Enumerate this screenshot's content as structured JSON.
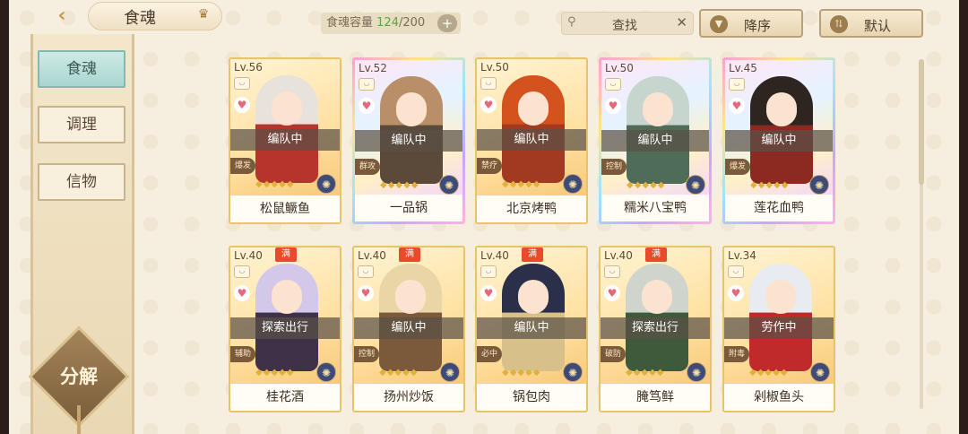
{
  "header": {
    "title": "食魂",
    "capacity_label": "食魂容量",
    "capacity_current": "124",
    "capacity_max": "/200",
    "capacity_add": "+",
    "search_placeholder": "查找",
    "search_clear": "✕",
    "sort_label": "降序",
    "default_label": "默认"
  },
  "sidebar": {
    "items": [
      {
        "label": "食魂",
        "active": true
      },
      {
        "label": "调理",
        "active": false
      },
      {
        "label": "信物",
        "active": false
      }
    ],
    "decompose_label": "分解"
  },
  "cards": [
    {
      "level": "Lv.56",
      "status": "编队中",
      "role": "爆发",
      "name": "松鼠鳜鱼",
      "full": false,
      "rainbow": false,
      "hair": "#e8e2dc",
      "outfit": "#b7342c"
    },
    {
      "level": "Lv.52",
      "status": "编队中",
      "role": "群攻",
      "name": "一品锅",
      "full": false,
      "rainbow": true,
      "hair": "#b98f6a",
      "outfit": "#5b4a3a"
    },
    {
      "level": "Lv.50",
      "status": "编队中",
      "role": "禁疗",
      "name": "北京烤鸭",
      "full": false,
      "rainbow": false,
      "hair": "#d4521e",
      "outfit": "#a23a22"
    },
    {
      "level": "Lv.50",
      "status": "编队中",
      "role": "控制",
      "name": "糯米八宝鸭",
      "full": false,
      "rainbow": true,
      "hair": "#c7d5cf",
      "outfit": "#4e6c58"
    },
    {
      "level": "Lv.45",
      "status": "编队中",
      "role": "爆发",
      "name": "莲花血鸭",
      "full": false,
      "rainbow": true,
      "hair": "#2d2520",
      "outfit": "#8c2a22"
    },
    {
      "level": "Lv.40",
      "status": "探索出行",
      "role": "辅助",
      "name": "桂花酒",
      "full": true,
      "rainbow": false,
      "hair": "#d3c8ea",
      "outfit": "#3f3148"
    },
    {
      "level": "Lv.40",
      "status": "编队中",
      "role": "控制",
      "name": "扬州炒饭",
      "full": true,
      "rainbow": false,
      "hair": "#e9d6a6",
      "outfit": "#7a5a3a"
    },
    {
      "level": "Lv.40",
      "status": "编队中",
      "role": "必中",
      "name": "锅包肉",
      "full": true,
      "rainbow": false,
      "hair": "#2a2f4a",
      "outfit": "#d8c08a"
    },
    {
      "level": "Lv.40",
      "status": "探索出行",
      "role": "破防",
      "name": "腌笃鲜",
      "full": true,
      "rainbow": false,
      "hair": "#cfd4cc",
      "outfit": "#3e5a3a"
    },
    {
      "level": "Lv.34",
      "status": "劳作中",
      "role": "附毒",
      "name": "剁椒鱼头",
      "full": false,
      "rainbow": false,
      "hair": "#e8ecf0",
      "outfit": "#c02a2a"
    }
  ],
  "badges": {
    "full": "满"
  },
  "stars": "◆◆◆◆◆",
  "icons": {
    "back": "back-arrow-icon",
    "crown": "crown-icon",
    "search": "search-icon",
    "sort": "sort-down-icon",
    "default": "filter-icon",
    "heart": "heart-icon",
    "element": "element-icon"
  },
  "colors": {
    "accent_gold": "#e8c36a",
    "active_tab": "#a9d6d0",
    "capacity_current": "#5aaa3a"
  }
}
